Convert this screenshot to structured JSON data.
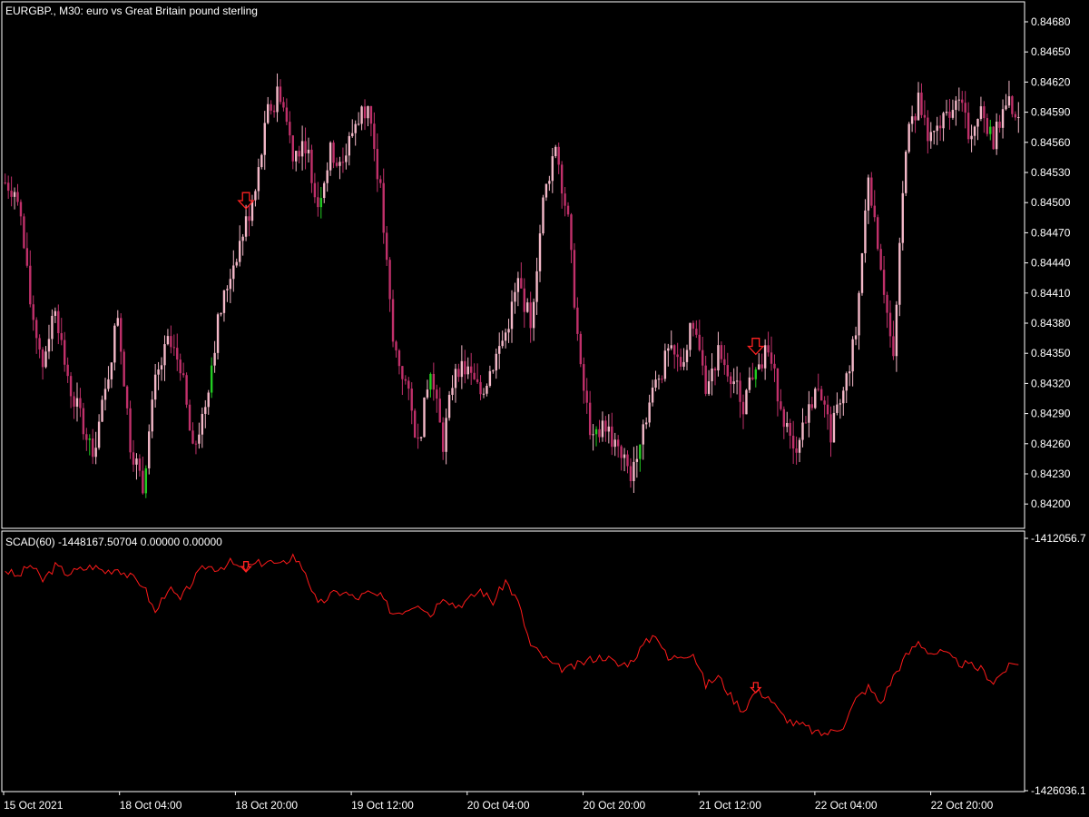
{
  "colors": {
    "background": "#000000",
    "frame": "#ffffff",
    "candle_bear": "#c0306a",
    "candle_bull": "#f4b8c8",
    "candle_bull_highlight": "#22cc22",
    "indicator_line": "#ff1a1a",
    "signal_arrow": "#ff2222"
  },
  "main_panel": {
    "title": "EURGBP., M30:  euro vs Great Britain pound sterling"
  },
  "indicator_panel": {
    "label": "SCAD(60) -1448167.50704 0.00000 0.00000",
    "axis_top_label": "-1412056.7",
    "axis_bottom_label": "-1426036.1"
  },
  "time_axis": {
    "labels": [
      "15 Oct 2021",
      "18 Oct 04:00",
      "18 Oct 20:00",
      "19 Oct 12:00",
      "20 Oct 04:00",
      "20 Oct 20:00",
      "21 Oct 12:00",
      "22 Oct 04:00",
      "22 Oct 20:00"
    ]
  },
  "chart_data": [
    {
      "type": "candlestick",
      "title": "EURGBP., M30:  euro vs Great Britain pound sterling",
      "y_ticks": [
        "0.84680",
        "0.84650",
        "0.84620",
        "0.84590",
        "0.84560",
        "0.84530",
        "0.84500",
        "0.84470",
        "0.84440",
        "0.84410",
        "0.84380",
        "0.84350",
        "0.84320",
        "0.84290",
        "0.84260",
        "0.84230",
        "0.84200"
      ],
      "ylim": [
        0.8419,
        0.8469
      ],
      "x_tick_labels": [
        "15 Oct 2021",
        "18 Oct 04:00",
        "18 Oct 20:00",
        "19 Oct 12:00",
        "20 Oct 04:00",
        "20 Oct 20:00",
        "21 Oct 12:00",
        "22 Oct 04:00",
        "22 Oct 20:00"
      ],
      "close_path": [
        [
          0,
          0.8452
        ],
        [
          4,
          0.8451
        ],
        [
          8,
          0.844
        ],
        [
          12,
          0.8434
        ],
        [
          16,
          0.844
        ],
        [
          20,
          0.8432
        ],
        [
          24,
          0.8429
        ],
        [
          28,
          0.8425
        ],
        [
          32,
          0.8431
        ],
        [
          36,
          0.8439
        ],
        [
          40,
          0.8426
        ],
        [
          44,
          0.8422
        ],
        [
          48,
          0.8432
        ],
        [
          52,
          0.8436
        ],
        [
          56,
          0.8434
        ],
        [
          60,
          0.8425
        ],
        [
          64,
          0.843
        ],
        [
          68,
          0.8438
        ],
        [
          72,
          0.8443
        ],
        [
          76,
          0.8447
        ],
        [
          80,
          0.8451
        ],
        [
          84,
          0.8459
        ],
        [
          88,
          0.8461
        ],
        [
          92,
          0.8455
        ],
        [
          96,
          0.8456
        ],
        [
          100,
          0.845
        ],
        [
          104,
          0.8455
        ],
        [
          108,
          0.8454
        ],
        [
          112,
          0.8458
        ],
        [
          116,
          0.846
        ],
        [
          120,
          0.8451
        ],
        [
          124,
          0.8436
        ],
        [
          128,
          0.8432
        ],
        [
          132,
          0.8426
        ],
        [
          136,
          0.8433
        ],
        [
          140,
          0.8426
        ],
        [
          144,
          0.8434
        ],
        [
          148,
          0.8433
        ],
        [
          152,
          0.8431
        ],
        [
          156,
          0.8434
        ],
        [
          160,
          0.8437
        ],
        [
          164,
          0.8442
        ],
        [
          168,
          0.8438
        ],
        [
          172,
          0.845
        ],
        [
          176,
          0.8456
        ],
        [
          180,
          0.8448
        ],
        [
          184,
          0.8433
        ],
        [
          188,
          0.8426
        ],
        [
          192,
          0.8428
        ],
        [
          196,
          0.8425
        ],
        [
          200,
          0.8423
        ],
        [
          204,
          0.8428
        ],
        [
          208,
          0.8432
        ],
        [
          212,
          0.8435
        ],
        [
          216,
          0.8434
        ],
        [
          220,
          0.8438
        ],
        [
          224,
          0.8432
        ],
        [
          228,
          0.8435
        ],
        [
          232,
          0.8433
        ],
        [
          236,
          0.843
        ],
        [
          240,
          0.8434
        ],
        [
          244,
          0.8435
        ],
        [
          248,
          0.843
        ],
        [
          252,
          0.8425
        ],
        [
          256,
          0.8429
        ],
        [
          260,
          0.8432
        ],
        [
          264,
          0.8427
        ],
        [
          268,
          0.8431
        ],
        [
          272,
          0.8437
        ],
        [
          276,
          0.8453
        ],
        [
          280,
          0.8444
        ],
        [
          284,
          0.8434
        ],
        [
          288,
          0.8456
        ],
        [
          292,
          0.846
        ],
        [
          296,
          0.8456
        ],
        [
          300,
          0.8458
        ],
        [
          304,
          0.8461
        ],
        [
          308,
          0.8457
        ],
        [
          312,
          0.8459
        ],
        [
          316,
          0.8456
        ],
        [
          320,
          0.846
        ],
        [
          324,
          0.8459
        ]
      ],
      "signals": [
        {
          "bar": 77,
          "direction": "down",
          "price": 0.845
        },
        {
          "bar": 240,
          "direction": "down",
          "price": 0.84355
        }
      ]
    },
    {
      "type": "line",
      "label": "SCAD(60) -1448167.50704 0.00000 0.00000",
      "ylim": [
        -1426036.1,
        -1412056.7
      ],
      "y_ticks": [
        "-1412056.7",
        "-1426036.1"
      ],
      "x": [
        0,
        4,
        8,
        12,
        16,
        20,
        24,
        28,
        32,
        36,
        40,
        44,
        48,
        52,
        56,
        60,
        64,
        68,
        72,
        76,
        80,
        84,
        88,
        92,
        96,
        100,
        104,
        108,
        112,
        116,
        120,
        124,
        128,
        132,
        136,
        140,
        144,
        148,
        152,
        156,
        160,
        164,
        168,
        172,
        176,
        180,
        184,
        188,
        192,
        196,
        200,
        204,
        208,
        212,
        216,
        220,
        224,
        228,
        232,
        236,
        240,
        244,
        248,
        252,
        256,
        260,
        264,
        268,
        272,
        276,
        280,
        284,
        288,
        292,
        296,
        300,
        304,
        308,
        312,
        316,
        320,
        324
      ],
      "values": [
        -1413800,
        -1414200,
        -1413500,
        -1414400,
        -1413600,
        -1414000,
        -1413800,
        -1413600,
        -1413900,
        -1413700,
        -1414200,
        -1414600,
        -1416200,
        -1414800,
        -1415500,
        -1414400,
        -1413600,
        -1413700,
        -1413400,
        -1413800,
        -1413500,
        -1413300,
        -1413600,
        -1413000,
        -1413900,
        -1415800,
        -1415200,
        -1415000,
        -1415400,
        -1415100,
        -1415300,
        -1416200,
        -1416000,
        -1415600,
        -1416300,
        -1415200,
        -1415800,
        -1415500,
        -1414900,
        -1415600,
        -1414400,
        -1415600,
        -1418000,
        -1418600,
        -1419200,
        -1419300,
        -1419000,
        -1418700,
        -1418600,
        -1419100,
        -1418900,
        -1418000,
        -1417300,
        -1418800,
        -1418500,
        -1418400,
        -1420200,
        -1419700,
        -1420800,
        -1421600,
        -1420500,
        -1420800,
        -1421800,
        -1422300,
        -1422500,
        -1422900,
        -1422800,
        -1422400,
        -1421000,
        -1420300,
        -1421200,
        -1419700,
        -1418600,
        -1417800,
        -1418400,
        -1418400,
        -1418900,
        -1419100,
        -1419300,
        -1420000,
        -1419300,
        -1418900
      ]
    }
  ]
}
